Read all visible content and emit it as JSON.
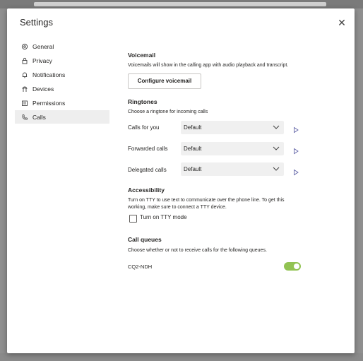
{
  "dialog": {
    "title": "Settings",
    "close_label": "✕"
  },
  "sidebar": {
    "items": [
      {
        "label": "General",
        "icon": "gear-icon"
      },
      {
        "label": "Privacy",
        "icon": "lock-icon"
      },
      {
        "label": "Notifications",
        "icon": "bell-icon"
      },
      {
        "label": "Devices",
        "icon": "devices-icon"
      },
      {
        "label": "Permissions",
        "icon": "permissions-icon"
      },
      {
        "label": "Calls",
        "icon": "phone-icon",
        "active": true
      }
    ]
  },
  "voicemail": {
    "heading": "Voicemail",
    "description": "Voicemails will show in the calling app with audio playback and transcript.",
    "button_label": "Configure voicemail"
  },
  "ringtones": {
    "heading": "Ringtones",
    "description": "Choose a ringtone for incoming calls",
    "rows": [
      {
        "label": "Calls for you",
        "value": "Default"
      },
      {
        "label": "Forwarded calls",
        "value": "Default"
      },
      {
        "label": "Delegated calls",
        "value": "Default"
      }
    ]
  },
  "accessibility": {
    "heading": "Accessibility",
    "description_line1": "Turn on TTY to use text to communicate over the phone line. To get this",
    "description_line2": "working, make sure to connect a TTY device.",
    "checkbox_label": "Turn on TTY mode",
    "checked": false
  },
  "call_queues": {
    "heading": "Call queues",
    "description": "Choose whether or not to receive calls for the following queues.",
    "queue_name": "CQ2-NDH",
    "enabled": true
  },
  "colors": {
    "toggle_on": "#92c353",
    "active_nav": "#eeeeee",
    "select_bg": "#f0f0f0"
  }
}
